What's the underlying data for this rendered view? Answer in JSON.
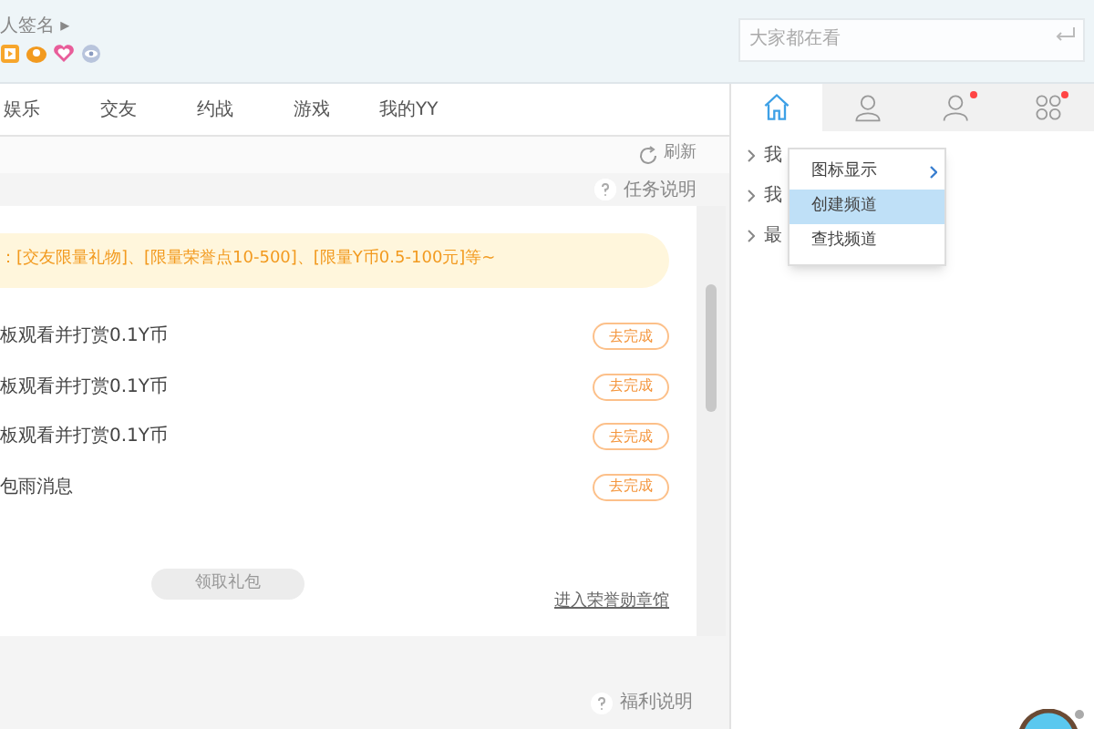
{
  "header": {
    "signature": "人签名 ▸",
    "search": {
      "placeholder": "大家都在看"
    }
  },
  "tabs": [
    {
      "label": "娱乐",
      "selected": false
    },
    {
      "label": "交友",
      "selected": false
    },
    {
      "label": "约战",
      "selected": false
    },
    {
      "label": "游戏",
      "selected": false
    },
    {
      "label": "我的YY",
      "selected": false
    }
  ],
  "toolbar": {
    "refresh": "刷新",
    "task_help": "任务说明"
  },
  "task_card": {
    "banner": "：[交友限量礼物]、[限量荣誉点10-500]、[限量Y币0.5-100元]等~",
    "tasks": [
      {
        "label": "板观看并打赏0.1Y币",
        "action": "去完成"
      },
      {
        "label": "板观看并打赏0.1Y币",
        "action": "去完成"
      },
      {
        "label": "板观看并打赏0.1Y币",
        "action": "去完成"
      },
      {
        "label": "包雨消息",
        "action": "去完成"
      }
    ],
    "claim_button": {
      "label": "领取礼包",
      "disabled": true
    },
    "link": "进入荣誉勋章馆"
  },
  "welfare_help": "福利说明",
  "side_panel": {
    "tabs": [
      {
        "kind": "home",
        "selected": true,
        "badge": false
      },
      {
        "kind": "person",
        "selected": false,
        "badge": false
      },
      {
        "kind": "contacts",
        "selected": false,
        "badge": true
      },
      {
        "kind": "apps",
        "selected": false,
        "badge": true
      }
    ],
    "items": [
      {
        "label": "我"
      },
      {
        "label": "我"
      },
      {
        "label": "最"
      }
    ]
  },
  "context_menu": [
    {
      "label": "图标显示",
      "submenu": true,
      "selected": false
    },
    {
      "label": "创建频道",
      "submenu": false,
      "selected": true
    },
    {
      "label": "查找频道",
      "submenu": false,
      "selected": false
    }
  ]
}
